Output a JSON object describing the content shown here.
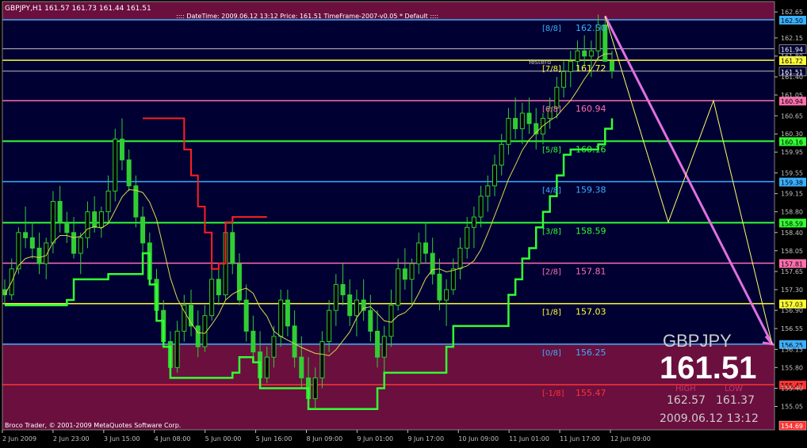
{
  "window": {
    "symbol_info": "GBPJPY,H1  161.57 161.73 161.44 161.51",
    "header_info": ":::: DateTime: 2009.06.12 13:12    Price: 161.51    TimeFrame-2007-v0.05     *  Default  ::::",
    "copyright": "Broco Trader, © 2001-2009 MetaQuotes Software Corp."
  },
  "overlay": {
    "symbol": "GBPJPY",
    "price": "161.51",
    "high_label": "HIGH",
    "low_label": "LOW",
    "high_value": "162.57",
    "low_value": "161.37",
    "datetime": "2009.06.12 13:12",
    "yesterday_partial": "Yesterd"
  },
  "colors": {
    "background": "#000000",
    "plot_bg": "#000033",
    "band_above": "#6b0f3f",
    "band_below": "#6b0f3f",
    "candle": "#32cd32",
    "mm_8_8": "#3ab0ff",
    "mm_7_8": "#ffff33",
    "mm_6_8": "#ff6fae",
    "mm_5_8": "#33ff33",
    "mm_4_8": "#3ab0ff",
    "mm_3_8": "#33ff33",
    "mm_2_8": "#ff6fae",
    "mm_1_8": "#ffff33",
    "mm_0_8": "#3ab0ff",
    "mm_m1_8": "#ff3333",
    "projection_pink": "#e070e0",
    "projection_yellow": "#ffff66",
    "stop_red": "#ff2020",
    "ma_yellow": "#d8d84a"
  },
  "chart_data": {
    "type": "candlestick",
    "symbol": "GBPJPY",
    "timeframe": "H1",
    "ylim": [
      154.6,
      162.85
    ],
    "price_ticks": [
      "162.65",
      "162.15",
      "161.80",
      "161.40",
      "161.05",
      "160.65",
      "160.30",
      "159.95",
      "159.55",
      "159.15",
      "158.80",
      "158.40",
      "158.05",
      "157.65",
      "157.30",
      "156.90",
      "156.55",
      "156.15",
      "155.80",
      "155.40",
      "155.05"
    ],
    "x_ticks": [
      "2 Jun 2009",
      "2 Jun 23:00",
      "3 Jun 15:00",
      "4 Jun 08:00",
      "5 Jun 00:00",
      "5 Jun 16:00",
      "8 Jun 09:00",
      "9 Jun 01:00",
      "9 Jun 17:00",
      "10 Jun 09:00",
      "11 Jun 01:00",
      "11 Jun 17:00",
      "12 Jun 09:00"
    ],
    "murrey_levels": [
      {
        "label": "[8/8]",
        "value": 162.5,
        "value_label": "162.50",
        "color_key": "mm_8_8"
      },
      {
        "label": "[7/8]",
        "value": 161.72,
        "value_label": "161.72",
        "color_key": "mm_7_8"
      },
      {
        "label": "[6/8]",
        "value": 160.94,
        "value_label": "160.94",
        "color_key": "mm_6_8"
      },
      {
        "label": "[5/8]",
        "value": 160.16,
        "value_label": "160.16",
        "color_key": "mm_5_8"
      },
      {
        "label": "[4/8]",
        "value": 159.38,
        "value_label": "159.38",
        "color_key": "mm_4_8"
      },
      {
        "label": "[3/8]",
        "value": 158.59,
        "value_label": "158.59",
        "color_key": "mm_3_8"
      },
      {
        "label": "[2/8]",
        "value": 157.81,
        "value_label": "157.81",
        "color_key": "mm_2_8"
      },
      {
        "label": "[1/8]",
        "value": 157.03,
        "value_label": "157.03",
        "color_key": "mm_1_8"
      },
      {
        "label": "[0/8]",
        "value": 156.25,
        "value_label": "156.25",
        "color_key": "mm_0_8"
      },
      {
        "label": "[-1/8]",
        "value": 155.47,
        "value_label": "155.47",
        "color_key": "mm_m1_8"
      }
    ],
    "price_markers": [
      {
        "value": 161.94,
        "label": "161.94",
        "bg": "#000033",
        "fg": "#ffffff"
      },
      {
        "value": 161.51,
        "label": "161.51",
        "bg": "#000033",
        "fg": "#ffffff"
      },
      {
        "value": 154.69,
        "label": "154.69",
        "bg": "#ff3333",
        "fg": "#ffffff"
      }
    ],
    "reference_lines": [
      {
        "value": 161.94,
        "color": "#c0c0c0"
      },
      {
        "value": 161.51,
        "color": "#c0c0c0"
      }
    ],
    "candles": [
      [
        157.3,
        157.5,
        157.0,
        157.2
      ],
      [
        157.2,
        157.9,
        157.1,
        157.7
      ],
      [
        157.7,
        158.5,
        157.6,
        158.4
      ],
      [
        158.4,
        158.9,
        158.1,
        158.3
      ],
      [
        158.3,
        158.6,
        157.9,
        158.1
      ],
      [
        158.1,
        158.4,
        157.6,
        157.8
      ],
      [
        157.8,
        158.3,
        157.5,
        158.2
      ],
      [
        158.2,
        159.2,
        158.0,
        159.0
      ],
      [
        159.0,
        159.3,
        158.4,
        158.6
      ],
      [
        158.6,
        158.8,
        158.2,
        158.4
      ],
      [
        158.4,
        158.7,
        157.9,
        158.0
      ],
      [
        158.0,
        158.4,
        157.6,
        158.3
      ],
      [
        158.3,
        159.0,
        158.1,
        158.8
      ],
      [
        158.8,
        159.1,
        158.4,
        158.5
      ],
      [
        158.5,
        158.9,
        158.3,
        158.8
      ],
      [
        158.8,
        159.5,
        158.6,
        159.2
      ],
      [
        159.2,
        160.4,
        159.0,
        160.2
      ],
      [
        160.2,
        160.6,
        159.6,
        159.8
      ],
      [
        159.8,
        160.0,
        159.2,
        159.3
      ],
      [
        159.3,
        159.5,
        158.5,
        158.7
      ],
      [
        158.7,
        158.9,
        158.0,
        158.2
      ],
      [
        158.2,
        158.4,
        157.4,
        157.5
      ],
      [
        157.5,
        157.7,
        156.7,
        156.9
      ],
      [
        156.9,
        157.1,
        156.2,
        156.3
      ],
      [
        156.3,
        156.5,
        155.6,
        155.8
      ],
      [
        155.8,
        156.7,
        155.7,
        156.5
      ],
      [
        156.5,
        157.2,
        156.3,
        157.0
      ],
      [
        157.0,
        157.3,
        156.4,
        156.6
      ],
      [
        156.6,
        156.9,
        156.0,
        156.2
      ],
      [
        156.2,
        157.0,
        156.1,
        156.8
      ],
      [
        156.8,
        157.7,
        156.7,
        157.5
      ],
      [
        157.5,
        157.8,
        157.0,
        157.2
      ],
      [
        157.2,
        158.6,
        157.1,
        158.4
      ],
      [
        158.4,
        158.7,
        157.6,
        157.8
      ],
      [
        157.8,
        158.0,
        157.0,
        157.1
      ],
      [
        157.1,
        157.4,
        156.3,
        156.5
      ],
      [
        156.5,
        156.8,
        155.9,
        156.1
      ],
      [
        156.1,
        156.5,
        155.4,
        155.6
      ],
      [
        155.6,
        156.2,
        155.5,
        156.0
      ],
      [
        156.0,
        156.6,
        155.8,
        156.4
      ],
      [
        156.4,
        157.3,
        156.2,
        157.1
      ],
      [
        157.1,
        157.3,
        156.4,
        156.6
      ],
      [
        156.6,
        156.9,
        155.8,
        156.0
      ],
      [
        156.0,
        156.4,
        155.4,
        155.6
      ],
      [
        155.6,
        156.0,
        155.0,
        155.2
      ],
      [
        155.2,
        155.8,
        155.0,
        155.6
      ],
      [
        155.6,
        156.5,
        155.4,
        156.3
      ],
      [
        156.3,
        157.1,
        156.1,
        156.9
      ],
      [
        156.9,
        157.6,
        156.6,
        157.4
      ],
      [
        157.4,
        157.8,
        157.0,
        157.2
      ],
      [
        157.2,
        157.5,
        156.6,
        156.8
      ],
      [
        156.8,
        157.3,
        156.4,
        157.1
      ],
      [
        157.1,
        157.5,
        156.7,
        156.9
      ],
      [
        156.9,
        157.2,
        156.3,
        156.5
      ],
      [
        156.5,
        156.9,
        155.8,
        156.0
      ],
      [
        156.0,
        156.6,
        155.7,
        156.4
      ],
      [
        156.4,
        157.3,
        156.2,
        157.0
      ],
      [
        157.0,
        157.9,
        156.9,
        157.7
      ],
      [
        157.7,
        158.1,
        157.3,
        157.5
      ],
      [
        157.5,
        157.9,
        157.0,
        157.8
      ],
      [
        157.8,
        158.4,
        157.6,
        158.2
      ],
      [
        158.2,
        158.6,
        157.8,
        158.0
      ],
      [
        158.0,
        158.3,
        157.4,
        157.6
      ],
      [
        157.6,
        157.9,
        156.9,
        157.1
      ],
      [
        157.1,
        157.5,
        156.6,
        157.3
      ],
      [
        157.3,
        157.9,
        157.2,
        157.7
      ],
      [
        157.7,
        158.3,
        157.5,
        158.1
      ],
      [
        158.1,
        158.7,
        157.9,
        158.5
      ],
      [
        158.5,
        158.9,
        158.1,
        158.7
      ],
      [
        158.7,
        159.3,
        158.5,
        159.1
      ],
      [
        159.1,
        159.5,
        158.8,
        159.3
      ],
      [
        159.3,
        159.9,
        159.1,
        159.7
      ],
      [
        159.7,
        160.3,
        159.5,
        160.1
      ],
      [
        160.1,
        160.8,
        159.9,
        160.6
      ],
      [
        160.6,
        161.0,
        160.2,
        160.4
      ],
      [
        160.4,
        160.9,
        160.1,
        160.7
      ],
      [
        160.7,
        161.0,
        160.3,
        160.5
      ],
      [
        160.5,
        160.8,
        160.0,
        160.3
      ],
      [
        160.3,
        160.7,
        160.1,
        160.6
      ],
      [
        160.6,
        161.0,
        160.4,
        160.8
      ],
      [
        160.8,
        161.4,
        160.6,
        161.2
      ],
      [
        161.2,
        161.7,
        161.0,
        161.5
      ],
      [
        161.5,
        161.9,
        161.2,
        161.7
      ],
      [
        161.7,
        162.1,
        161.5,
        161.9
      ],
      [
        161.9,
        162.2,
        161.6,
        161.8
      ],
      [
        161.8,
        162.1,
        161.4,
        161.9
      ],
      [
        161.9,
        162.6,
        161.7,
        162.4
      ],
      [
        162.4,
        162.57,
        161.9,
        161.7
      ],
      [
        161.7,
        161.9,
        161.37,
        161.51
      ]
    ],
    "x_label": "",
    "y_label": ""
  }
}
